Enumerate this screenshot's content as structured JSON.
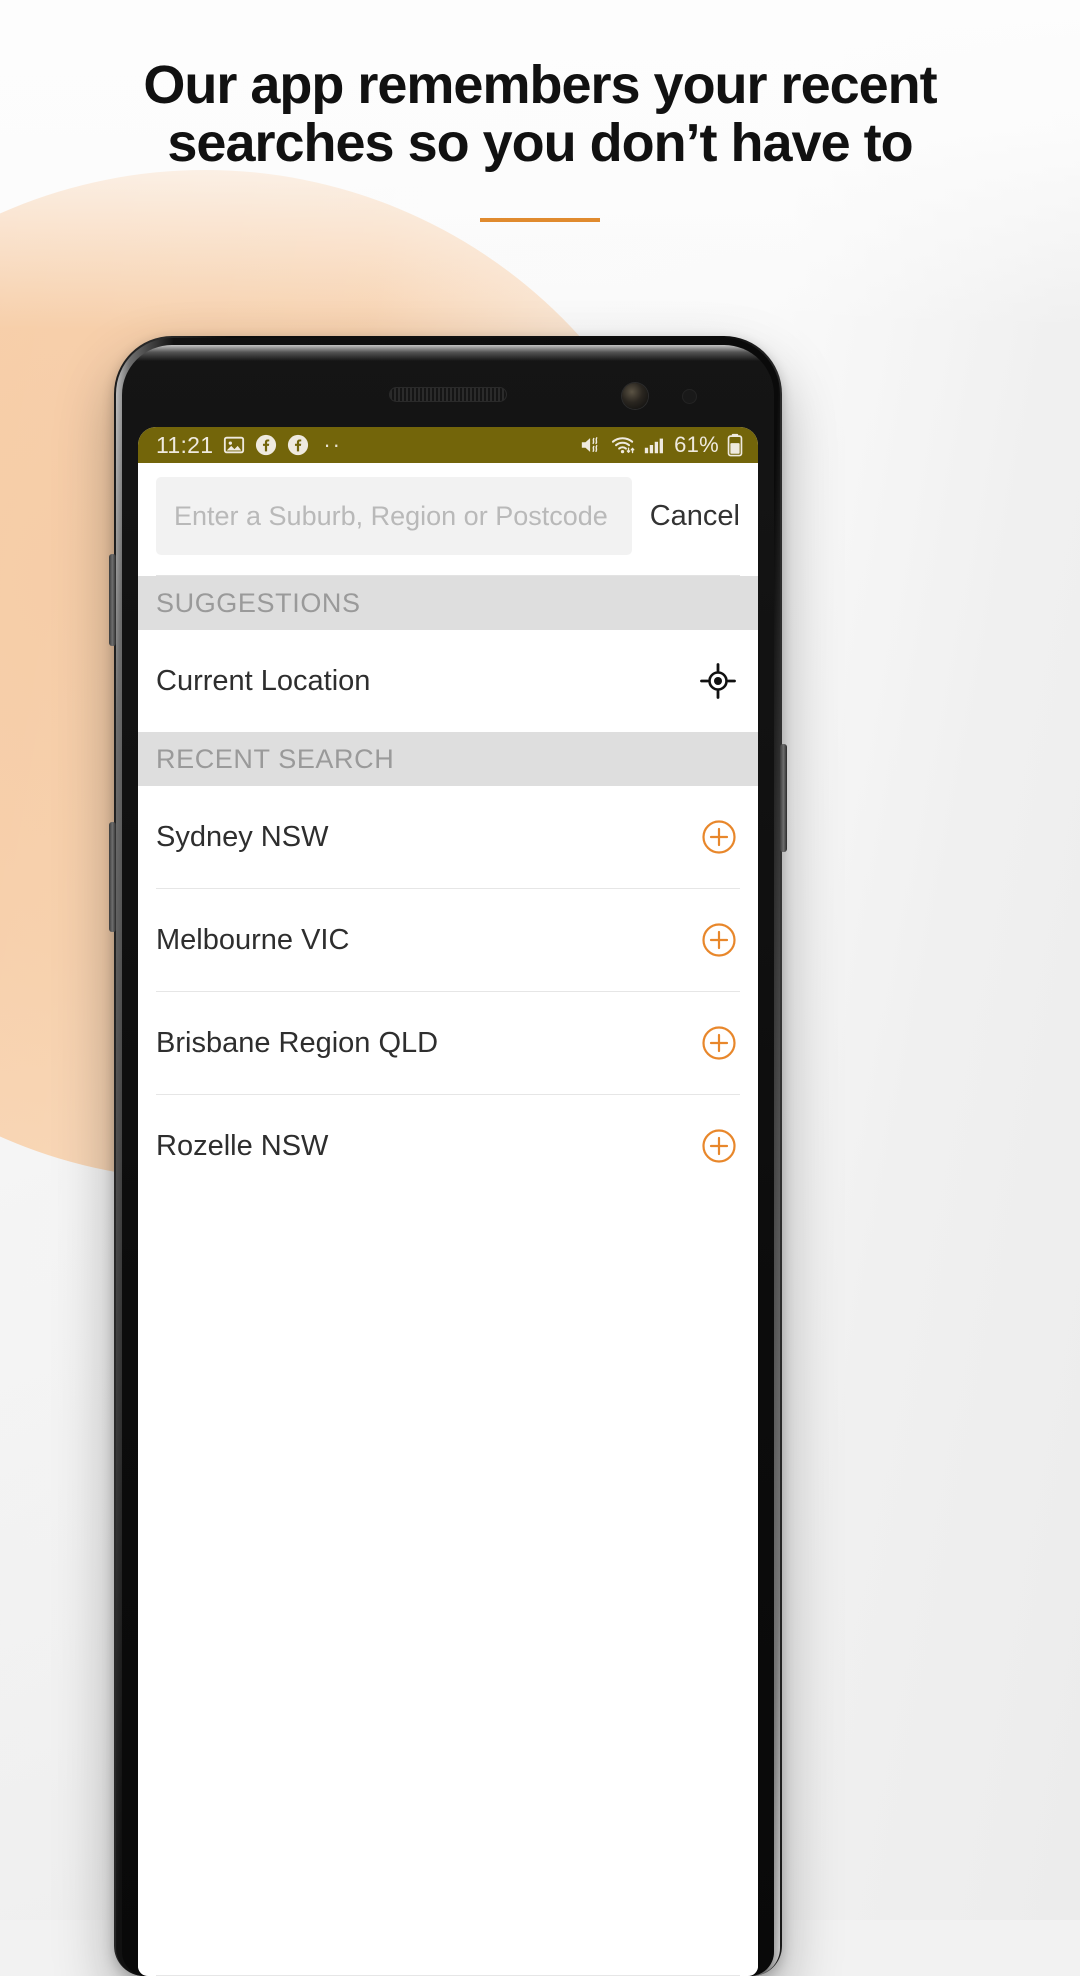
{
  "promo": {
    "headline_line1": "Our app remembers your recent",
    "headline_line2": "searches so you don’t have to",
    "accent_color": "#e08a2e"
  },
  "phone": {
    "status_bar": {
      "time": "11:21",
      "battery_percent": "61%",
      "background_color": "#73650a",
      "left_icons": [
        "photo-icon",
        "facebook-icon",
        "facebook-icon",
        "more-dots-icon"
      ],
      "right_icons": [
        "mute-vibrate-icon",
        "wifi-icon",
        "cellular-signal-icon",
        "battery-icon"
      ]
    },
    "search": {
      "placeholder": "Enter a Suburb, Region or Postcode",
      "value": "",
      "cancel_label": "Cancel"
    },
    "sections": [
      {
        "header": "SUGGESTIONS",
        "items": [
          {
            "label": "Current Location",
            "icon": "gps-target-icon"
          }
        ]
      },
      {
        "header": "RECENT SEARCH",
        "items": [
          {
            "label": "Sydney NSW",
            "icon": "add-circle-icon"
          },
          {
            "label": "Melbourne VIC",
            "icon": "add-circle-icon"
          },
          {
            "label": "Brisbane Region QLD",
            "icon": "add-circle-icon"
          },
          {
            "label": "Rozelle NSW",
            "icon": "add-circle-icon"
          }
        ]
      }
    ],
    "colors": {
      "accent_orange": "#e8872b",
      "section_band": "#dedede",
      "field_background": "#f2f2f2"
    }
  }
}
